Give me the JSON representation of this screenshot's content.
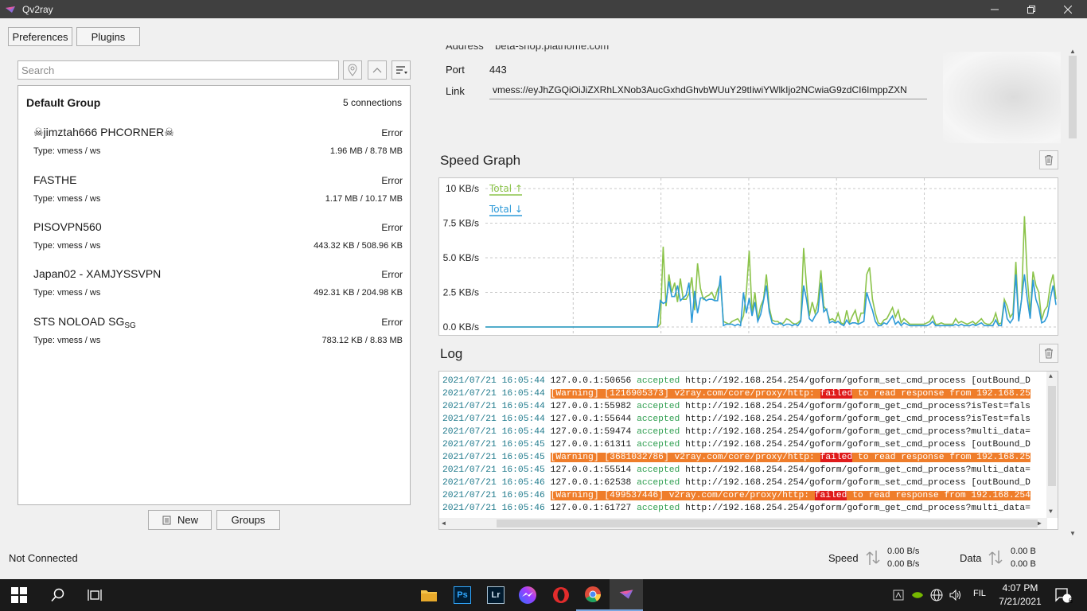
{
  "window": {
    "title": "Qv2ray"
  },
  "toolbar": {
    "preferences_label": "Preferences",
    "plugins_label": "Plugins"
  },
  "search": {
    "placeholder": "Search"
  },
  "group": {
    "name": "Default Group",
    "count": "5 connections"
  },
  "connections": [
    {
      "name": "☠jimztah666 PHCORNER☠",
      "status": "Error",
      "type": "Type: vmess / ws",
      "usage": "1.96 MB / 8.78 MB"
    },
    {
      "name": "FASTHE",
      "status": "Error",
      "type": "Type: vmess / ws",
      "usage": "1.17 MB / 10.17 MB"
    },
    {
      "name": "PISOVPN560",
      "status": "Error",
      "type": "Type: vmess / ws",
      "usage": "443.32 KB / 508.96 KB"
    },
    {
      "name": "Japan02 - XAMJYSSVPN",
      "status": "Error",
      "type": "Type: vmess / ws",
      "usage": "492.31 KB / 204.98 KB"
    },
    {
      "name": "STS NOLOAD SG",
      "name_sub": "SG",
      "status": "Error",
      "type": "Type: vmess / ws",
      "usage": "783.12 KB / 8.83 MB"
    }
  ],
  "bottom_buttons": {
    "new_label": "New",
    "groups_label": "Groups"
  },
  "details": {
    "address_label": "Address",
    "address_value": "beta-shop.plathome.com",
    "port_label": "Port",
    "port_value": "443",
    "link_label": "Link",
    "link_value": "vmess://eyJhZGQiOiJiZXRhLXNob3AucGxhdGhvbWUuY29tIiwiYWlkIjo2NCwiaG9zdCI6ImppZXN"
  },
  "speed_graph": {
    "title": "Speed Graph"
  },
  "chart_data": {
    "type": "line",
    "title": "",
    "ylim": [
      0,
      10
    ],
    "y_ticks": [
      "10 KB/s",
      "7.5 KB/s",
      "5.0 KB/s",
      "2.5 KB/s",
      "0.0 KB/s"
    ],
    "legend_placement": "top-left",
    "grid": true,
    "series": [
      {
        "name": "Total ↑",
        "color": "#8bc34a",
        "values": [
          0,
          0,
          0,
          0,
          0,
          0,
          0,
          0,
          0,
          0,
          0,
          0,
          0,
          0,
          0,
          0,
          0,
          0,
          0,
          0,
          0,
          0,
          0,
          0,
          0,
          0,
          0,
          0,
          0,
          0,
          0,
          0,
          0,
          0,
          0,
          0,
          0,
          0,
          0,
          0,
          0,
          0,
          0,
          0,
          0,
          0,
          0,
          0,
          0,
          0,
          0,
          0,
          0,
          0,
          0,
          0,
          0,
          0,
          0,
          0,
          0,
          0.2,
          5.8,
          1.5,
          3.8,
          2.5,
          3.2,
          1.8,
          3.5,
          2.0,
          2.0,
          2.4,
          3.6,
          1.2,
          4.6,
          2.8,
          2.0,
          2.2,
          2.3,
          2.5,
          2.0,
          2.7,
          3.2,
          0.4,
          0.3,
          0.2,
          0.4,
          0.5,
          0.6,
          0.3,
          0.8,
          2.5,
          5.5,
          1.0,
          2.5,
          0.5,
          1.5,
          2.0,
          3.8,
          1.4,
          0.5,
          0.4,
          0.4,
          0.2,
          0.3,
          0.6,
          0.5,
          0.3,
          0.2,
          0.3,
          0.5,
          5.7,
          3.0,
          0.8,
          1.8,
          1.0,
          1.8,
          4.1,
          1.5,
          1.2,
          0.5,
          0.6,
          0.4,
          1.0,
          0.3,
          0.2,
          1.2,
          0.3,
          0.8,
          1.2,
          0.3,
          1.0,
          1.0,
          3.8,
          4.3,
          2.0,
          1.0,
          0.3,
          0.2,
          0.5,
          0.6,
          1.0,
          1.4,
          0.7,
          1.2,
          0.3,
          0.6,
          0.4,
          0.2,
          0.2,
          0.2,
          0.2,
          0.2,
          0.2,
          0.3,
          0.4,
          0.8,
          0.2,
          0.2,
          0.3,
          0.2,
          0.2,
          0.2,
          0.2,
          0.6,
          0.3,
          0.4,
          0.3,
          0.2,
          0.3,
          0.4,
          0.2,
          0.4,
          0.6,
          0.3,
          0.2,
          0.2,
          0.4,
          1.0,
          0.2,
          0.3,
          2.0,
          1.5,
          0.7,
          1.0,
          4.7,
          0.5,
          2.0,
          8.0,
          3.5,
          1.0,
          4.0,
          3.0,
          2.5,
          0.5,
          1.2,
          1.5,
          3.0,
          3.8,
          2.0
        ]
      },
      {
        "name": "Total ↓",
        "color": "#2d9ad8",
        "values": [
          0,
          0,
          0,
          0,
          0,
          0,
          0,
          0,
          0,
          0,
          0,
          0,
          0,
          0,
          0,
          0,
          0,
          0,
          0,
          0,
          0,
          0,
          0,
          0,
          0,
          0,
          0,
          0,
          0,
          0,
          0,
          0,
          0,
          0,
          0,
          0,
          0,
          0,
          0,
          0,
          0,
          0,
          0,
          0,
          0,
          0,
          0,
          0,
          0,
          0,
          0,
          0,
          0,
          0,
          0,
          0,
          0,
          0,
          0,
          0,
          0,
          1.9,
          1.7,
          1.8,
          3.3,
          2.2,
          2.2,
          3.0,
          1.9,
          2.1,
          2.3,
          3.2,
          0.3,
          2.6,
          1.0,
          2.1,
          2.1,
          1.9,
          2.0,
          2.0,
          1.9,
          1.9,
          3.7,
          0.1,
          0.2,
          0.2,
          0.2,
          0.1,
          0.2,
          0.1,
          2.5,
          1.0,
          2.1,
          0.8,
          1.8,
          0.4,
          0.9,
          1.9,
          3.0,
          1.1,
          0.3,
          0.2,
          0.2,
          0.3,
          0.1,
          0.2,
          0.2,
          0.1,
          0.2,
          0.1,
          0.4,
          3.0,
          2.0,
          0.6,
          0.4,
          0.8,
          1.1,
          3.2,
          1.1,
          1.3,
          0.3,
          0.4,
          0.3,
          0.4,
          0.2,
          0.1,
          0.5,
          0.2,
          0.3,
          0.3,
          0.2,
          0.3,
          0.4,
          2.5,
          1.8,
          1.2,
          0.4,
          0.1,
          0.1,
          0.3,
          0.2,
          0.5,
          0.8,
          0.2,
          0.4,
          0.1,
          0.3,
          0.2,
          0.1,
          0.1,
          0.1,
          0.1,
          0.1,
          0.1,
          0.1,
          0.2,
          0.4,
          0.1,
          0.1,
          0.1,
          0.1,
          0.1,
          0.1,
          0.1,
          0.2,
          0.1,
          0.2,
          0.1,
          0.1,
          0.1,
          0.2,
          0.1,
          0.2,
          0.3,
          0.1,
          0.1,
          0.1,
          0.1,
          0.5,
          0.1,
          0.1,
          1.8,
          0.6,
          0.3,
          0.6,
          3.8,
          0.4,
          2.0,
          3.8,
          2.0,
          0.6,
          3.4,
          2.0,
          1.4,
          0.3,
          0.4,
          0.8,
          2.0,
          3.0,
          1.6
        ]
      }
    ]
  },
  "log": {
    "title": "Log",
    "lines": [
      {
        "kind": "normal",
        "ts": "2021/07/21 16:05:44",
        "addr": "127.0.0.1:50656",
        "verb": "accepted",
        "rest": "http://192.168.254.254/goform/goform_set_cmd_process [outBound_D"
      },
      {
        "kind": "warn",
        "ts": "2021/07/21 16:05:44",
        "pre": "[Warning] [1216905373] v2ray.com/core/proxy/http: ",
        "failed": "failed",
        "post": " to read response from 192.168.25"
      },
      {
        "kind": "normal",
        "ts": "2021/07/21 16:05:44",
        "addr": "127.0.0.1:55982",
        "verb": "accepted",
        "rest": "http://192.168.254.254/goform/goform_get_cmd_process?isTest=fals"
      },
      {
        "kind": "normal",
        "ts": "2021/07/21 16:05:44",
        "addr": "127.0.0.1:55644",
        "verb": "accepted",
        "rest": "http://192.168.254.254/goform/goform_get_cmd_process?isTest=fals"
      },
      {
        "kind": "normal",
        "ts": "2021/07/21 16:05:44",
        "addr": "127.0.0.1:59474",
        "verb": "accepted",
        "rest": "http://192.168.254.254/goform/goform_get_cmd_process?multi_data="
      },
      {
        "kind": "normal",
        "ts": "2021/07/21 16:05:45",
        "addr": "127.0.0.1:61311",
        "verb": "accepted",
        "rest": "http://192.168.254.254/goform/goform_set_cmd_process [outBound_D"
      },
      {
        "kind": "warn",
        "ts": "2021/07/21 16:05:45",
        "pre": "[Warning] [3681032786] v2ray.com/core/proxy/http: ",
        "failed": "failed",
        "post": " to read response from 192.168.25"
      },
      {
        "kind": "normal",
        "ts": "2021/07/21 16:05:45",
        "addr": "127.0.0.1:55514",
        "verb": "accepted",
        "rest": "http://192.168.254.254/goform/goform_get_cmd_process?multi_data="
      },
      {
        "kind": "normal",
        "ts": "2021/07/21 16:05:46",
        "addr": "127.0.0.1:62538",
        "verb": "accepted",
        "rest": "http://192.168.254.254/goform/goform_set_cmd_process [outBound_D"
      },
      {
        "kind": "warn",
        "ts": "2021/07/21 16:05:46",
        "pre": "[Warning] [499537446] v2ray.com/core/proxy/http: ",
        "failed": "failed",
        "post": " to read response from 192.168.254"
      },
      {
        "kind": "normal",
        "ts": "2021/07/21 16:05:46",
        "addr": "127.0.0.1:61727",
        "verb": "accepted",
        "rest": "http://192.168.254.254/goform/goform_get_cmd_process?multi_data="
      }
    ]
  },
  "statusbar": {
    "connection_status": "Not Connected",
    "speed_label": "Speed",
    "speed_up": "0.00 B/s",
    "speed_down": "0.00 B/s",
    "data_label": "Data",
    "data_up": "0.00 B",
    "data_down": "0.00 B"
  },
  "taskbar": {
    "time": "4:07 PM",
    "date": "7/21/2021",
    "language": "FIL",
    "notification_count": "6",
    "pinned_apps": [
      "file-explorer-icon",
      "photoshop-icon",
      "lightroom-icon",
      "messenger-icon",
      "opera-icon",
      "chrome-icon",
      "qv2ray-icon"
    ],
    "ps_label": "Ps",
    "lr_label": "Lr"
  },
  "colors": {
    "upload": "#8bc34a",
    "download": "#2d9ad8",
    "warning_bg": "#ef7d2a",
    "failed_bg": "#e01b1b",
    "timestamp": "#1f7a8c",
    "accepted": "#2e9e4f"
  }
}
